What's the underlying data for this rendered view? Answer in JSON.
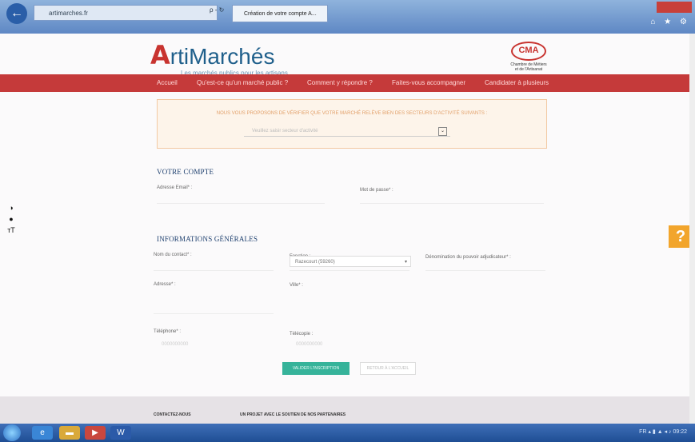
{
  "browser": {
    "address": "artimarches.fr",
    "address_controls": "ρ - ↻",
    "tab_title": "Création de votre compte A...",
    "toolbar_icons": "⌂ ★ ⚙"
  },
  "brand": {
    "logo_mark": "A",
    "logo_rest": "rtiMarchés",
    "tagline": "Les marchés publics pour les artisans",
    "partner_badge": "CMA",
    "partner_text": "Chambre de Métiers et de l'Artisanat"
  },
  "nav": {
    "items": [
      "Accueil",
      "Qu'est-ce qu'un marché public ?",
      "Comment y répondre ?",
      "Faites-vous accompagner",
      "Candidater à plusieurs"
    ]
  },
  "notice": {
    "text": "NOUS VOUS PROPOSONS DE VÉRIFIER QUE VOTRE MARCHÉ RELÈVE BIEN DES SECTEURS D'ACTIVITÉ SUIVANTS :",
    "select_placeholder": "Veuillez saisir secteur d'activité"
  },
  "account": {
    "title": "VOTRE COMPTE",
    "email_label": "Adresse Email* :",
    "password_label": "Mot de passe* :"
  },
  "general": {
    "title": "INFORMATIONS GÉNÉRALES",
    "contact_label": "Nom du contact* :",
    "function_label": "Fonction :",
    "denomination_label": "Dénomination du pouvoir adjudicateur* :",
    "address_label": "Adresse* :",
    "city_label": "Ville* :",
    "city_value": "Razecourt (59260)",
    "phone_label": "Téléphone* :",
    "phone_placeholder": "0000000000",
    "fax_label": "Télécopie :",
    "fax_placeholder": "0000000000"
  },
  "actions": {
    "submit": "VALIDER L'INSCRIPTION",
    "back": "RETOUR À L'ACCUEIL"
  },
  "footer": {
    "contact": "CONTACTEZ-NOUS",
    "partners": "UN PROJET AVEC LE SOUTIEN DE NOS PARTENAIRES"
  },
  "side": {
    "contrast_icon": "◑",
    "drop_icon": "●",
    "text_size_icon": "тT",
    "help_label": "?"
  },
  "taskbar": {
    "word_label": "W",
    "tray": "FR ▴ ▮ ▲ ◂ ♪   09:22"
  }
}
